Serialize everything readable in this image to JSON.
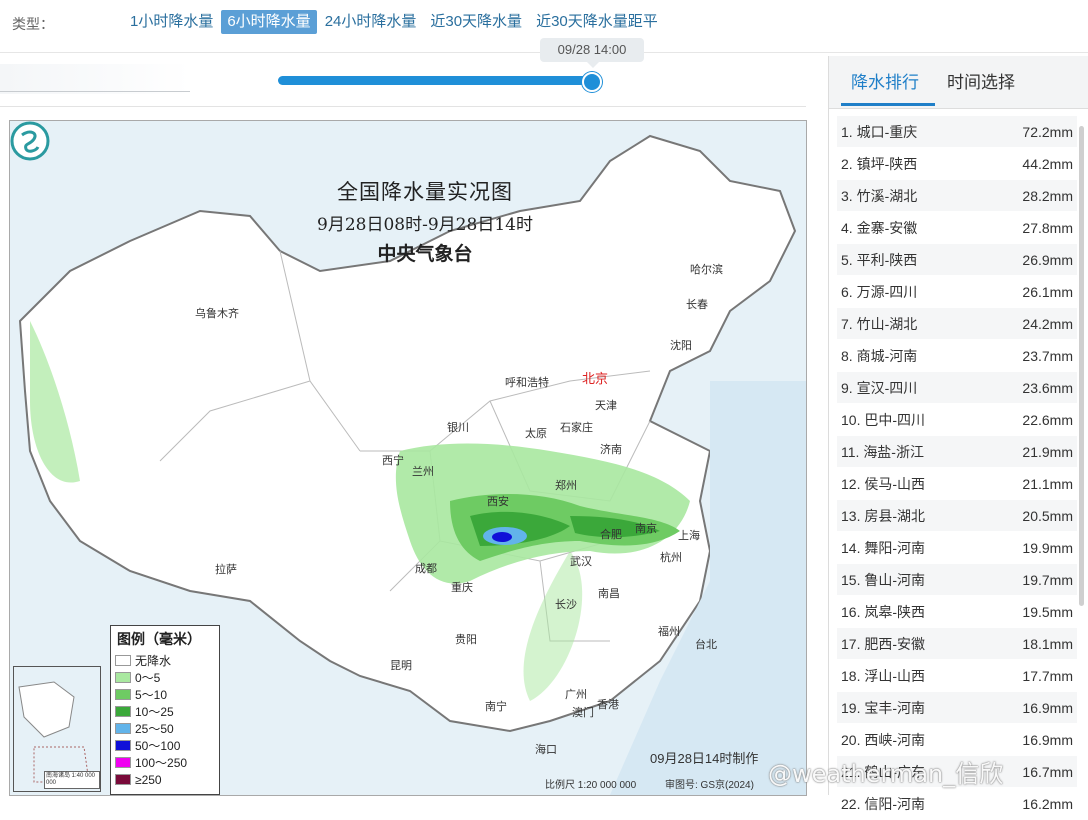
{
  "filter": {
    "label": "类型：",
    "tabs": [
      {
        "label": "1小时降水量",
        "active": false
      },
      {
        "label": "6小时降水量",
        "active": true
      },
      {
        "label": "24小时降水量",
        "active": false
      },
      {
        "label": "近30天降水量",
        "active": false
      },
      {
        "label": "近30天降水量距平",
        "active": false
      }
    ]
  },
  "timeline": {
    "tooltip": "09/28 14:00",
    "position_fraction": 1.0
  },
  "map": {
    "title": "全国降水量实况图",
    "subtitle": "9月28日08时-9月28日14时",
    "org": "中央气象台",
    "made": "09月28日14时制作",
    "scale": "比例尺 1:20 000 000",
    "review": "审图号: GS京(2024)",
    "inset_scale": "南海诸岛 1:40 000 000",
    "cities": [
      "乌鲁木齐",
      "哈尔滨",
      "长春",
      "沈阳",
      "呼和浩特",
      "北京",
      "天津",
      "石家庄",
      "太原",
      "银川",
      "西宁",
      "兰州",
      "济南",
      "郑州",
      "西安",
      "合肥",
      "南京",
      "上海",
      "成都",
      "重庆",
      "武汉",
      "杭州",
      "长沙",
      "南昌",
      "拉萨",
      "贵阳",
      "福州",
      "台北",
      "昆明",
      "广州",
      "香港",
      "澳门",
      "南宁",
      "海口"
    ],
    "legend": {
      "title": "图例（毫米）",
      "items": [
        {
          "label": "无降水",
          "color": "#ffffff"
        },
        {
          "label": "0～5",
          "color": "#a9e8a0"
        },
        {
          "label": "5～10",
          "color": "#6ecb63"
        },
        {
          "label": "10～25",
          "color": "#3ba83a"
        },
        {
          "label": "25～50",
          "color": "#62b4ea"
        },
        {
          "label": "50～100",
          "color": "#1010d8"
        },
        {
          "label": "100～250",
          "color": "#f000f0"
        },
        {
          "label": "≥250",
          "color": "#7a0a3a"
        }
      ]
    }
  },
  "panel": {
    "tabs": [
      {
        "label": "降水排行",
        "active": true
      },
      {
        "label": "时间选择",
        "active": false
      }
    ],
    "ranking": [
      {
        "name": "1. 城口-重庆",
        "value": "72.2mm"
      },
      {
        "name": "2. 镇坪-陕西",
        "value": "44.2mm"
      },
      {
        "name": "3. 竹溪-湖北",
        "value": "28.2mm"
      },
      {
        "name": "4. 金寨-安徽",
        "value": "27.8mm"
      },
      {
        "name": "5. 平利-陕西",
        "value": "26.9mm"
      },
      {
        "name": "6. 万源-四川",
        "value": "26.1mm"
      },
      {
        "name": "7. 竹山-湖北",
        "value": "24.2mm"
      },
      {
        "name": "8. 商城-河南",
        "value": "23.7mm"
      },
      {
        "name": "9. 宣汉-四川",
        "value": "23.6mm"
      },
      {
        "name": "10. 巴中-四川",
        "value": "22.6mm"
      },
      {
        "name": "11. 海盐-浙江",
        "value": "21.9mm"
      },
      {
        "name": "12. 侯马-山西",
        "value": "21.1mm"
      },
      {
        "name": "13. 房县-湖北",
        "value": "20.5mm"
      },
      {
        "name": "14. 舞阳-河南",
        "value": "19.9mm"
      },
      {
        "name": "15. 鲁山-河南",
        "value": "19.7mm"
      },
      {
        "name": "16. 岚皋-陕西",
        "value": "19.5mm"
      },
      {
        "name": "17. 肥西-安徽",
        "value": "18.1mm"
      },
      {
        "name": "18. 浮山-山西",
        "value": "17.7mm"
      },
      {
        "name": "19. 宝丰-河南",
        "value": "16.9mm"
      },
      {
        "name": "20. 西峡-河南",
        "value": "16.9mm"
      },
      {
        "name": "21. 鹤山-广东",
        "value": "16.7mm"
      },
      {
        "name": "22. 信阳-河南",
        "value": "16.2mm"
      }
    ]
  },
  "watermark": "@weatherman_信欣"
}
